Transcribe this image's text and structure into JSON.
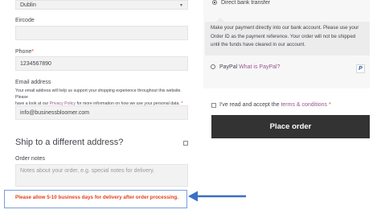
{
  "county": {
    "value": "Dublin"
  },
  "eircode": {
    "label": "Eircode"
  },
  "phone": {
    "label": "Phone",
    "required_mark": "*",
    "value": "1234567890"
  },
  "email": {
    "label": "Email address",
    "privacy_text_1": "Your email address will help us support your shopping experience throughout this website. Please",
    "privacy_text_2": "have a look at our",
    "privacy_link": "Privacy Policy",
    "privacy_text_3": "for more information on how we use your personal data.",
    "required_mark": "*",
    "value": "info@businessbloomer.com"
  },
  "ship_different": {
    "label": "Ship to a different address?"
  },
  "order_notes": {
    "label": "Order notes",
    "placeholder": "Notes about your order, e.g. special notes for delivery."
  },
  "notice": {
    "text": "Please allow 5-10 business days for delivery after order processing."
  },
  "payment": {
    "bank_transfer": {
      "label": "Direct bank transfer",
      "description": "Make your payment directly into our bank account. Please use your Order ID as the payment reference. Your order will not be shipped until the funds have cleared in our account."
    },
    "paypal": {
      "label": "PayPal",
      "link": "What is PayPal?",
      "badge": "P"
    }
  },
  "terms": {
    "text": "I've read and accept the",
    "link": "terms & conditions",
    "required_mark": "*"
  },
  "place_order": {
    "label": "Place order"
  },
  "colors": {
    "accent_link": "#96588a",
    "required": "#e2401c",
    "button_bg": "#333333",
    "arrow": "#3b6fc4"
  }
}
